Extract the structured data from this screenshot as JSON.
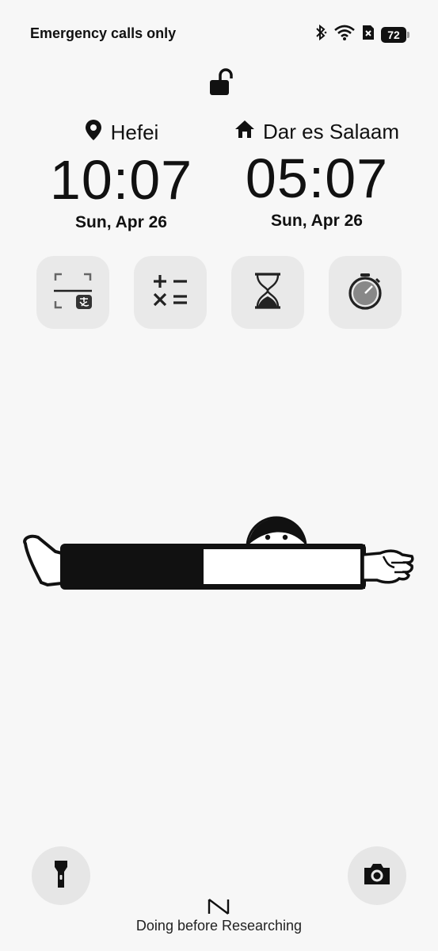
{
  "status_bar": {
    "carrier": "Emergency calls only",
    "battery": "72",
    "icons": [
      "bluetooth-icon",
      "wifi-icon",
      "no-sim-icon",
      "battery-icon"
    ]
  },
  "lock_icon": "lock-open-icon",
  "clocks": [
    {
      "city": "Hefei",
      "icon": "location-pin-icon",
      "time": "10:07",
      "date": "Sun, Apr 26"
    },
    {
      "city": "Dar es Salaam",
      "icon": "home-icon",
      "time": "05:07",
      "date": "Sun, Apr 26"
    }
  ],
  "shortcuts": [
    "scan-pay-icon",
    "calculator-icon",
    "timer-hourglass-icon",
    "stopwatch-icon"
  ],
  "bottom": {
    "left_button": "flashlight-icon",
    "right_button": "camera-icon",
    "caption": "Doing before Researching"
  }
}
